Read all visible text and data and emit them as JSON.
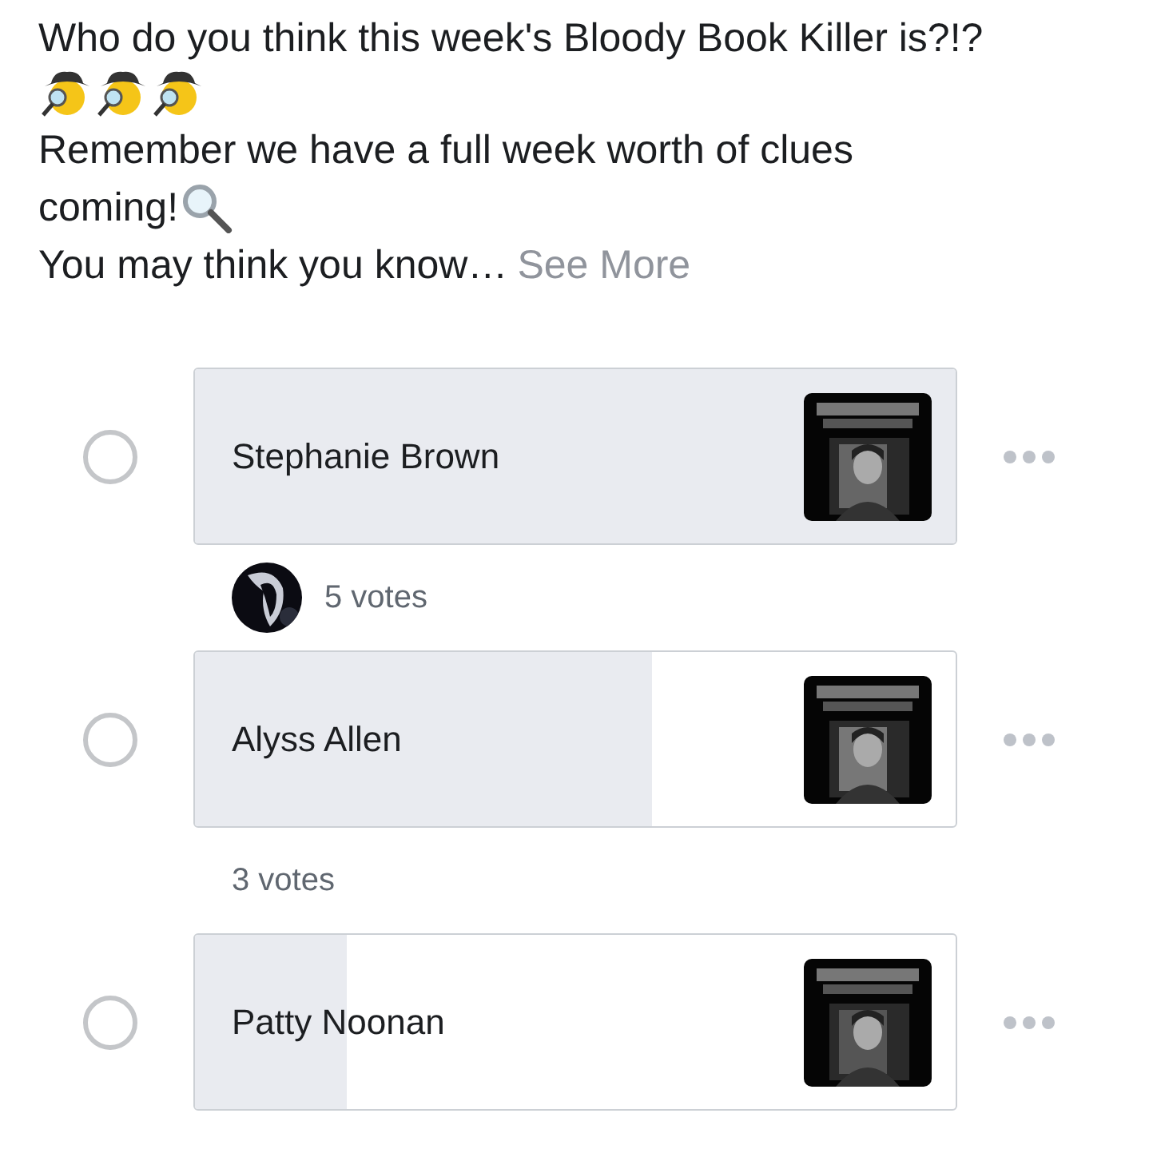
{
  "post": {
    "title": "Who do you think this week's Bloody Book Killer is?!?",
    "lines": [
      "Remember we have a full week worth of clues",
      "coming!"
    ],
    "teaser": "You may think you know…",
    "see_more": "See More"
  },
  "poll": {
    "options": [
      {
        "name": "Stephanie Brown",
        "selected": false,
        "level": 1,
        "votes": "5 votes",
        "voter_avatar": true
      },
      {
        "name": "Alyss Allen",
        "selected": false,
        "level": 0.6,
        "votes": "3 votes",
        "voter_avatar": false
      },
      {
        "name": "Patty Noonan",
        "selected": false,
        "level": 0.2
      }
    ]
  }
}
